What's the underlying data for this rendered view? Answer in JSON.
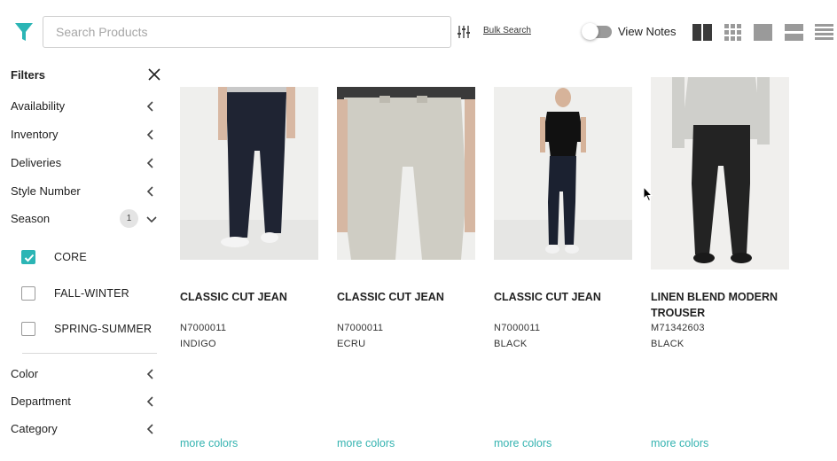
{
  "header": {
    "search_placeholder": "Search Products",
    "search_value": "",
    "bulk_search_label": "Bulk Search",
    "view_notes_label": "View Notes",
    "view_notes_on": false,
    "view_modes": [
      "large-grid-view",
      "small-grid-view",
      "single-image-view",
      "list-view",
      "compact-list-view"
    ],
    "accent_color": "#2bb5b5"
  },
  "sidebar": {
    "title": "Filters",
    "filters": [
      {
        "label": "Availability",
        "expanded": false
      },
      {
        "label": "Inventory",
        "expanded": false
      },
      {
        "label": "Deliveries",
        "expanded": false
      },
      {
        "label": "Style Number",
        "expanded": false
      },
      {
        "label": "Season",
        "expanded": true,
        "badge": "1"
      }
    ],
    "season_options": [
      {
        "label": "CORE",
        "checked": true
      },
      {
        "label": "FALL-WINTER",
        "checked": false
      },
      {
        "label": "SPRING-SUMMER",
        "checked": false
      }
    ],
    "more_filters": [
      {
        "label": "Color",
        "expanded": false
      },
      {
        "label": "Department",
        "expanded": false
      },
      {
        "label": "Category",
        "expanded": false
      }
    ]
  },
  "products": [
    {
      "name": "CLASSIC CUT JEAN",
      "sku": "N7000011",
      "color": "INDIGO",
      "more_colors": "more colors",
      "pant_color": "#1f2433",
      "top_color": "#c9c9c9",
      "image": "jean-indigo-photo"
    },
    {
      "name": "CLASSIC CUT JEAN",
      "sku": "N7000011",
      "color": "ECRU",
      "more_colors": "more colors",
      "pant_color": "#cfcdc4",
      "top_color": "#3a3a3a",
      "image": "jean-ecru-photo"
    },
    {
      "name": "CLASSIC CUT JEAN",
      "sku": "N7000011",
      "color": "BLACK",
      "more_colors": "more colors",
      "pant_color": "#1b2130",
      "top_color": "#111111",
      "image": "jean-black-photo"
    },
    {
      "name": "LINEN BLEND MODERN TROUSER",
      "sku": "M71342603",
      "color": "BLACK",
      "more_colors": "more colors",
      "pant_color": "#232323",
      "top_color": "#cfcfcb",
      "image": "trouser-black-photo"
    }
  ]
}
